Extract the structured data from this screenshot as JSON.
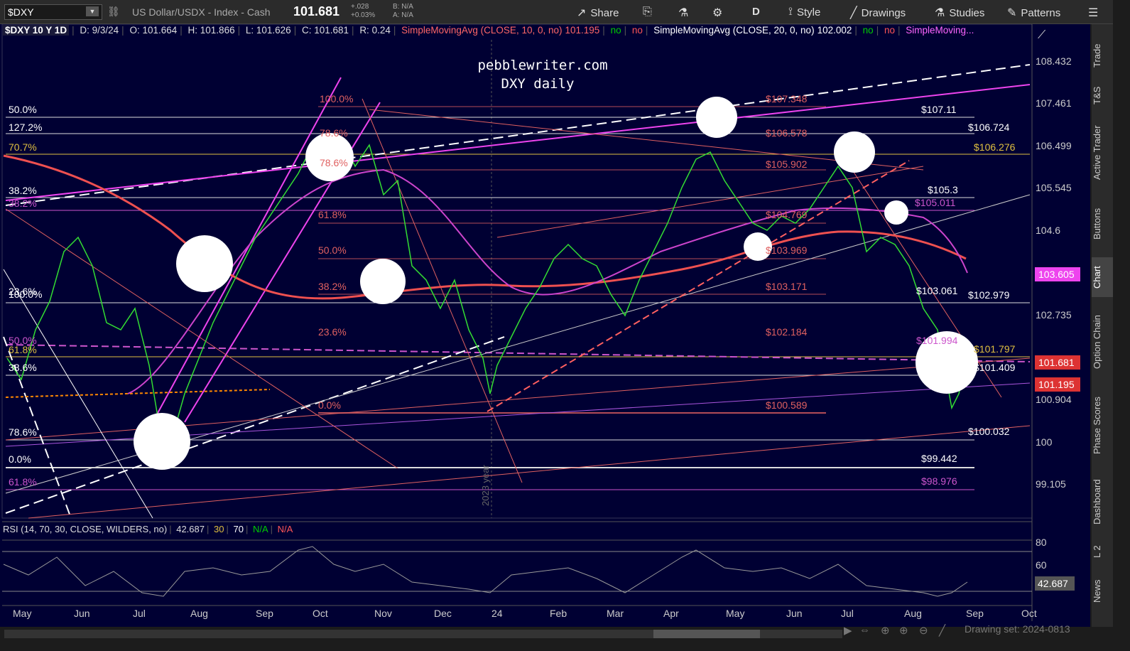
{
  "toolbar": {
    "symbol": "$DXY",
    "description": "US Dollar/USDX - Index - Cash",
    "last": "101.681",
    "change": "+.028",
    "change_pct": "+0.03%",
    "bid": "B: N/A",
    "ask": "A: N/A",
    "share": "Share",
    "period": "D",
    "style": "Style",
    "drawings": "Drawings",
    "studies": "Studies",
    "patterns": "Patterns"
  },
  "studybar": {
    "symbol": "$DXY 10 Y 1D",
    "date": "D: 9/3/24",
    "open": "O: 101.664",
    "high": "H: 101.866",
    "low": "L: 101.626",
    "close": "C: 101.681",
    "range": "R: 0.24",
    "sma1_name": "SimpleMovingAvg (CLOSE, 10, 0, no)",
    "sma1_val": "101.195",
    "no1": "no",
    "no2": "no",
    "sma2_name": "SimpleMovingAvg (CLOSE, 20, 0, no)",
    "sma2_val": "102.002",
    "no3": "no",
    "no4": "no",
    "sma3_name": "SimpleMoving..."
  },
  "watermark": {
    "line1": "pebblewriter.com",
    "line2": "DXY daily"
  },
  "y_axis": [
    "108.432",
    "107.461",
    "106.499",
    "105.545",
    "104.6",
    "102.735",
    "100.904",
    "100",
    "99.105"
  ],
  "x_axis": [
    "May",
    "Jun",
    "Jul",
    "Aug",
    "Sep",
    "Oct",
    "Nov",
    "Dec",
    "24",
    "Feb",
    "Mar",
    "Apr",
    "May",
    "Jun",
    "Jul",
    "Aug",
    "Sep",
    "Oct"
  ],
  "year_marker": "2023 year",
  "price_tags": {
    "sma20": "103.605",
    "last": "101.681",
    "sma10": "101.195",
    "rsi": "42.687"
  },
  "fib_left": [
    "50.0%",
    "127.2%",
    "70.7%",
    "38.2%",
    "38.2%",
    "23.6%",
    "100.0%",
    "50.0%",
    "61.8%",
    "38.6%",
    "78.6%",
    "0.0%",
    "61.8%"
  ],
  "fib_mid": [
    "100.0%",
    "78.6%",
    "78.6%",
    "61.8%",
    "50.0%",
    "38.2%",
    "23.6%",
    "0.0%"
  ],
  "fib_mid_prices": [
    "$107.348",
    "$106.578",
    "$105.902",
    "$104.769",
    "$103.969",
    "$103.171",
    "$102.184",
    "$100.589"
  ],
  "level_labels": [
    "$107.11",
    "$106.724",
    "$106.276",
    "$105.3",
    "$105.011",
    "$103.061",
    "$102.979",
    "$101.994",
    "$101.797",
    "$101.409",
    "$100.032",
    "$99.442",
    "$98.976"
  ],
  "rsi": {
    "label": "RSI (14, 70, 30, CLOSE, WILDERS, no)",
    "value": "42.687",
    "ob": "30",
    "os": "70",
    "na1": "N/A",
    "na2": "N/A",
    "levels": [
      "80",
      "60"
    ]
  },
  "sidetabs": [
    "Trade",
    "T&S",
    "Active Trader",
    "Buttons",
    "Chart",
    "Option Chain",
    "Phase Scores",
    "Dashboard",
    "L 2",
    "News"
  ],
  "bottom": {
    "drawing_set": "Drawing set: 2024-0813"
  }
}
